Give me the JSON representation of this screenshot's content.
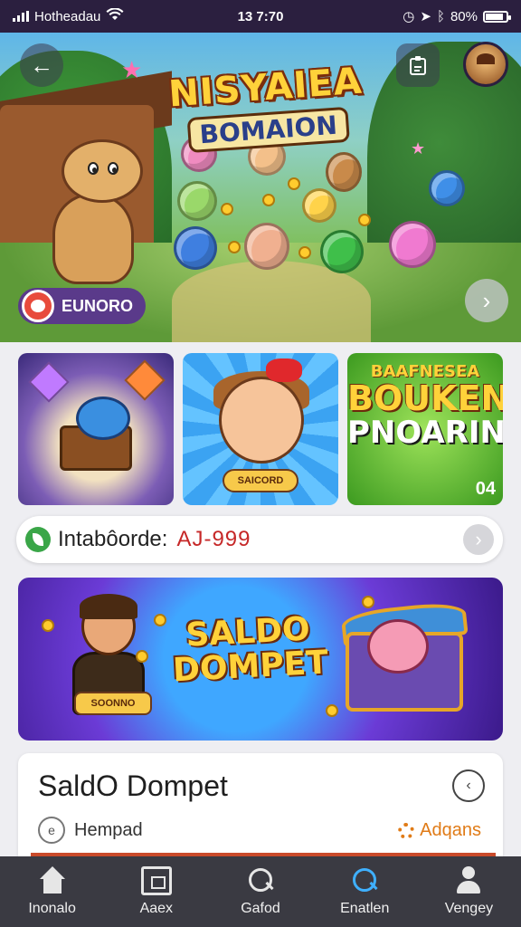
{
  "status_bar": {
    "carrier": "Hotheadau",
    "time": "13 7:70",
    "battery_text": "80%",
    "battery_level": 0.8,
    "icons": [
      "signal-icon",
      "wifi-icon",
      "alarm-icon",
      "location-icon",
      "bluetooth-icon",
      "battery-icon"
    ]
  },
  "hero": {
    "title_line1": "NISYAIEA",
    "title_line2": "BOMAION",
    "back_icon": "back-arrow-icon",
    "share_icon": "share-icon",
    "next_icon": "chevron-right-icon",
    "brand_label": "EUNORO"
  },
  "thumbnails": {
    "second_badge": "SAICORD",
    "third_line1": "BAAFNESEA",
    "third_line2": "BOUKEN",
    "third_line3": "PNOARIN!",
    "third_corner": "04"
  },
  "info_bar": {
    "label": "Intabôorde:",
    "value": "AJ-999",
    "arrow_icon": "chevron-right-icon"
  },
  "promo": {
    "title_line1": "SALDO",
    "title_line2": "DOMPET",
    "badge": "SOONNO"
  },
  "card": {
    "title": "SaldO Dompet",
    "meta_label": "Hempad",
    "action_label": "Adqans"
  },
  "bottom_nav": {
    "items": [
      {
        "label": "Inonalo",
        "icon": "home-icon"
      },
      {
        "label": "Aaex",
        "icon": "document-icon"
      },
      {
        "label": "Gafod",
        "icon": "search-icon"
      },
      {
        "label": "Enatlen",
        "icon": "search-active-icon"
      },
      {
        "label": "Vengey",
        "icon": "user-icon"
      }
    ]
  },
  "colors": {
    "status_bar_bg": "#2b1f3f",
    "nav_bg": "#3a3a42",
    "info_value": "#c62828",
    "accent_orange": "#e07b17",
    "active_nav": "#3fb0ff"
  }
}
